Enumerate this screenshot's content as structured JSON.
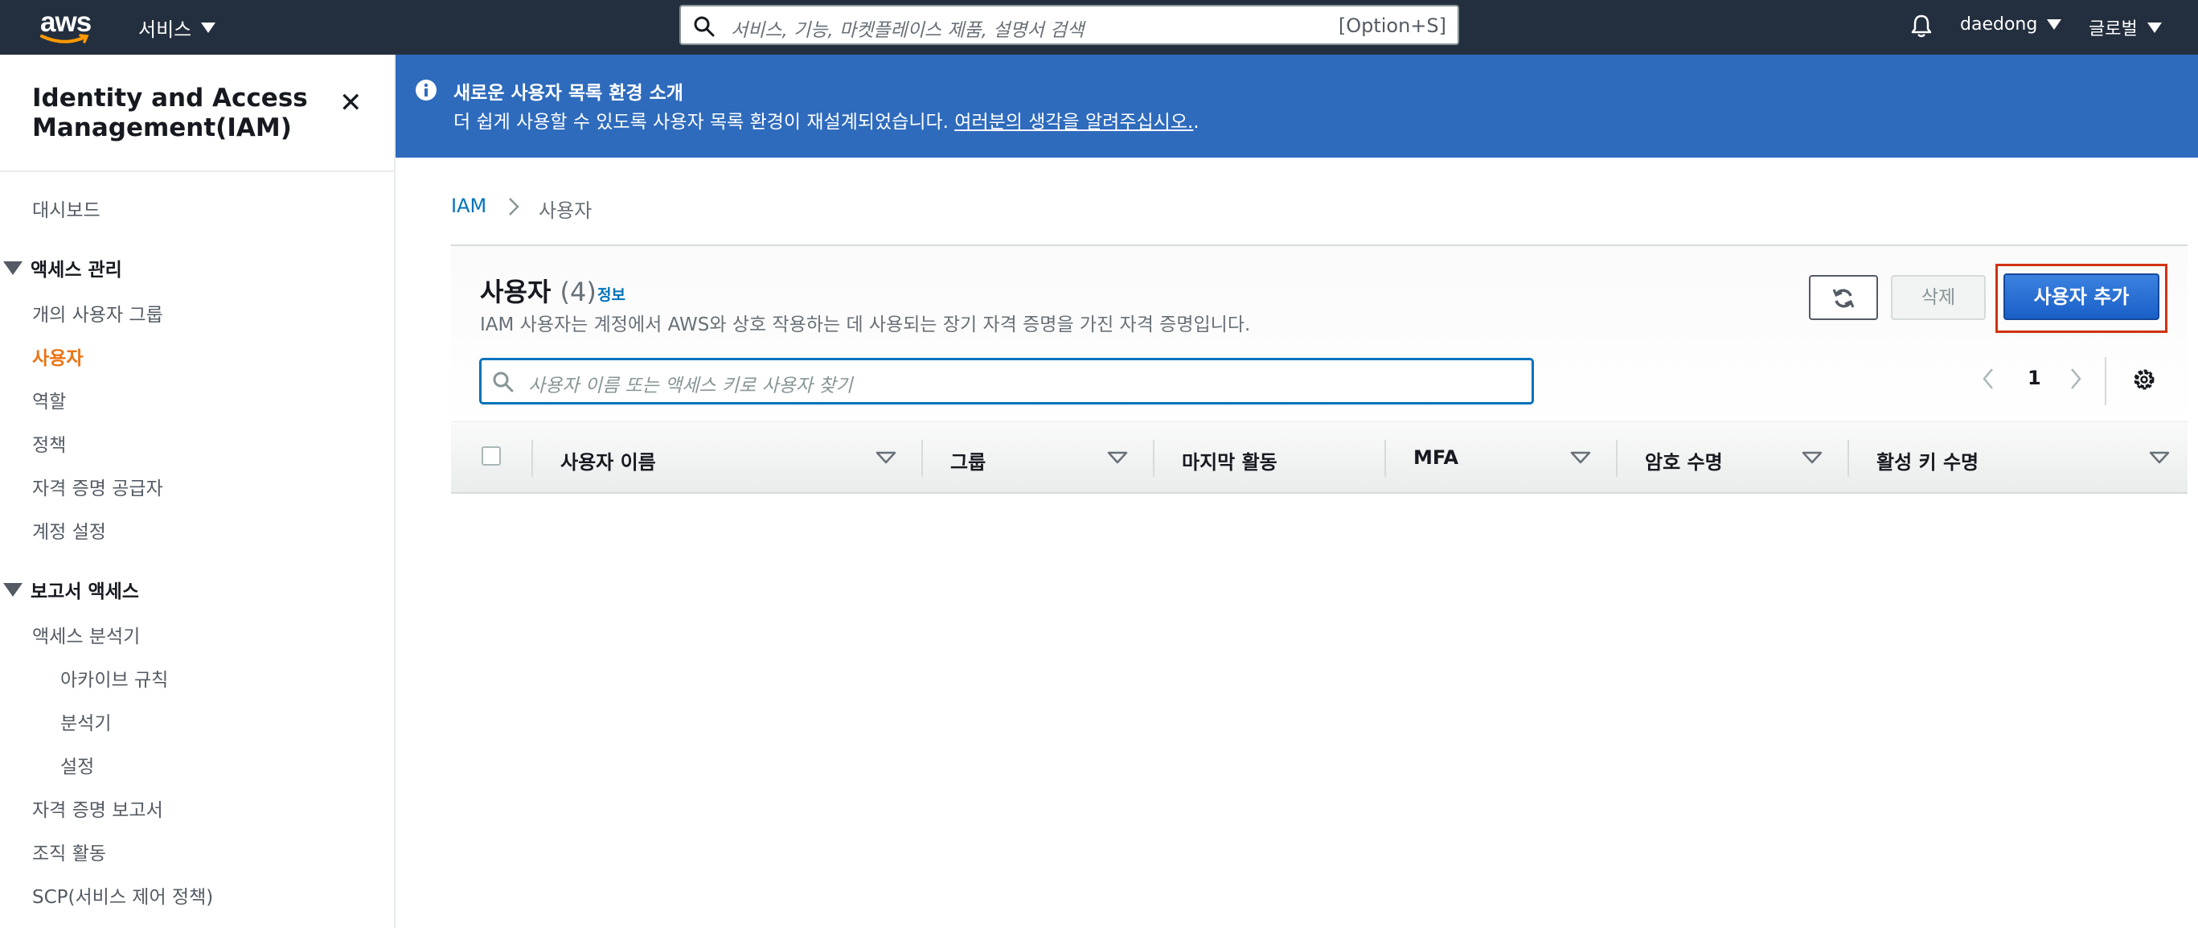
{
  "topnav": {
    "logo_text": "aws",
    "services_label": "서비스",
    "search_placeholder": "서비스, 기능, 마켓플레이스 제품, 설명서 검색",
    "search_shortcut": "[Option+S]",
    "username": "daedong",
    "region": "글로벌"
  },
  "sidebar": {
    "title_line1": "Identity and Access",
    "title_line2": "Management(IAM)",
    "dashboard": "대시보드",
    "section_access": "액세스 관리",
    "items_access": [
      "개의 사용자 그룹",
      "사용자",
      "역할",
      "정책",
      "자격 증명 공급자",
      "계정 설정"
    ],
    "active_item": "사용자",
    "section_report": "보고서 액세스",
    "items_report": [
      "액세스 분석기",
      "아카이브 규칙",
      "분석기",
      "설정",
      "자격 증명 보고서",
      "조직 활동",
      "SCP(서비스 제어 정책)"
    ]
  },
  "banner": {
    "title": "새로운 사용자 목록 환경 소개",
    "body": "더 쉽게 사용할 수 있도록 사용자 목록 환경이 재설계되었습니다. ",
    "link": "여러분의 생각을 알려주십시오.",
    "body_end": "."
  },
  "breadcrumb": {
    "root": "IAM",
    "current": "사용자"
  },
  "users_panel": {
    "title": "사용자",
    "count": "(4)",
    "info_link": "정보",
    "description": "IAM 사용자는 계정에서 AWS와 상호 작용하는 데 사용되는 장기 자격 증명을 가진 자격 증명입니다.",
    "delete_label": "삭제",
    "add_label": "사용자 추가",
    "search_placeholder": "사용자 이름 또는 액세스 키로 사용자 찾기",
    "page_number": "1",
    "columns": [
      "사용자 이름",
      "그룹",
      "마지막 활동",
      "MFA",
      "암호 수명",
      "활성 키 수명"
    ]
  },
  "colors": {
    "nav_bg": "#232f3e",
    "banner_bg": "#2e6bbd",
    "primary_button": "#1f6fd8",
    "active_nav": "#ec7211",
    "highlight": "#d13212"
  }
}
